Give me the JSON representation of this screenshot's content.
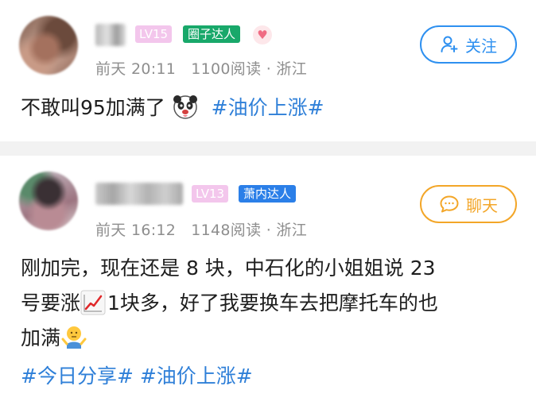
{
  "posts": [
    {
      "level": "LV15",
      "badge": "圈子达人",
      "heart_glyph": "♥",
      "time": "前天 20:11",
      "reads": "1100阅读",
      "dot": "·",
      "location": "浙江",
      "action_label": "关注",
      "action_icon": "add-user-icon",
      "text": "不敢叫95加满了",
      "emoji": "panda-emoji",
      "topics": [
        "#油价上涨#"
      ],
      "colors": {
        "badge": "#18a86a",
        "action": "#2e90f0"
      }
    },
    {
      "level": "LV13",
      "badge": "萧内达人",
      "time": "前天 16:12",
      "reads": "1148阅读",
      "dot": "·",
      "location": "浙江",
      "action_label": "聊天",
      "action_icon": "chat-bubble-icon",
      "text_line1": "刚加完，现在还是 8 块，中石化的小姐姐说 23",
      "text_line2a": "号要涨",
      "text_line2b": "1块多，好了我要换车去把摩托车的也",
      "text_line3": "加满",
      "emojis": [
        "chart-increasing-emoji",
        "shrug-emoji"
      ],
      "topics": [
        "#今日分享#",
        "#油价上涨#"
      ],
      "colors": {
        "badge": "#2b7fe8",
        "action": "#f3a628"
      }
    }
  ],
  "colors": {
    "level_badge": "#f3c6ec",
    "topic": "#2e7fd8",
    "meta": "#8e8e8e"
  }
}
